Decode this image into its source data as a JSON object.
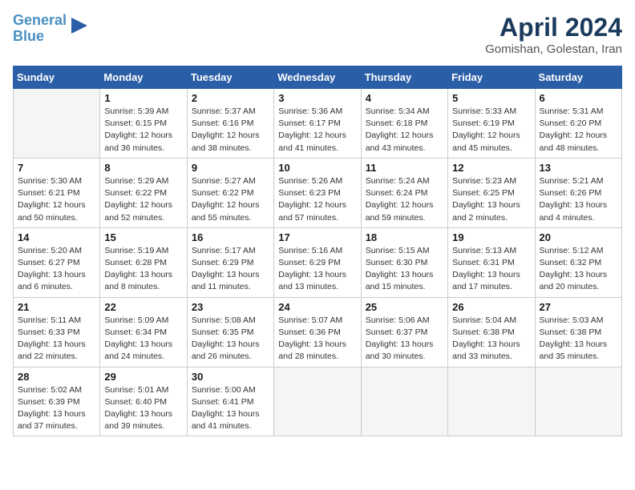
{
  "header": {
    "logo_line1": "General",
    "logo_line2": "Blue",
    "month_title": "April 2024",
    "location": "Gomishan, Golestan, Iran"
  },
  "calendar": {
    "days_of_week": [
      "Sunday",
      "Monday",
      "Tuesday",
      "Wednesday",
      "Thursday",
      "Friday",
      "Saturday"
    ],
    "weeks": [
      [
        {
          "num": "",
          "info": ""
        },
        {
          "num": "1",
          "info": "Sunrise: 5:39 AM\nSunset: 6:15 PM\nDaylight: 12 hours\nand 36 minutes."
        },
        {
          "num": "2",
          "info": "Sunrise: 5:37 AM\nSunset: 6:16 PM\nDaylight: 12 hours\nand 38 minutes."
        },
        {
          "num": "3",
          "info": "Sunrise: 5:36 AM\nSunset: 6:17 PM\nDaylight: 12 hours\nand 41 minutes."
        },
        {
          "num": "4",
          "info": "Sunrise: 5:34 AM\nSunset: 6:18 PM\nDaylight: 12 hours\nand 43 minutes."
        },
        {
          "num": "5",
          "info": "Sunrise: 5:33 AM\nSunset: 6:19 PM\nDaylight: 12 hours\nand 45 minutes."
        },
        {
          "num": "6",
          "info": "Sunrise: 5:31 AM\nSunset: 6:20 PM\nDaylight: 12 hours\nand 48 minutes."
        }
      ],
      [
        {
          "num": "7",
          "info": "Sunrise: 5:30 AM\nSunset: 6:21 PM\nDaylight: 12 hours\nand 50 minutes."
        },
        {
          "num": "8",
          "info": "Sunrise: 5:29 AM\nSunset: 6:22 PM\nDaylight: 12 hours\nand 52 minutes."
        },
        {
          "num": "9",
          "info": "Sunrise: 5:27 AM\nSunset: 6:22 PM\nDaylight: 12 hours\nand 55 minutes."
        },
        {
          "num": "10",
          "info": "Sunrise: 5:26 AM\nSunset: 6:23 PM\nDaylight: 12 hours\nand 57 minutes."
        },
        {
          "num": "11",
          "info": "Sunrise: 5:24 AM\nSunset: 6:24 PM\nDaylight: 12 hours\nand 59 minutes."
        },
        {
          "num": "12",
          "info": "Sunrise: 5:23 AM\nSunset: 6:25 PM\nDaylight: 13 hours\nand 2 minutes."
        },
        {
          "num": "13",
          "info": "Sunrise: 5:21 AM\nSunset: 6:26 PM\nDaylight: 13 hours\nand 4 minutes."
        }
      ],
      [
        {
          "num": "14",
          "info": "Sunrise: 5:20 AM\nSunset: 6:27 PM\nDaylight: 13 hours\nand 6 minutes."
        },
        {
          "num": "15",
          "info": "Sunrise: 5:19 AM\nSunset: 6:28 PM\nDaylight: 13 hours\nand 8 minutes."
        },
        {
          "num": "16",
          "info": "Sunrise: 5:17 AM\nSunset: 6:29 PM\nDaylight: 13 hours\nand 11 minutes."
        },
        {
          "num": "17",
          "info": "Sunrise: 5:16 AM\nSunset: 6:29 PM\nDaylight: 13 hours\nand 13 minutes."
        },
        {
          "num": "18",
          "info": "Sunrise: 5:15 AM\nSunset: 6:30 PM\nDaylight: 13 hours\nand 15 minutes."
        },
        {
          "num": "19",
          "info": "Sunrise: 5:13 AM\nSunset: 6:31 PM\nDaylight: 13 hours\nand 17 minutes."
        },
        {
          "num": "20",
          "info": "Sunrise: 5:12 AM\nSunset: 6:32 PM\nDaylight: 13 hours\nand 20 minutes."
        }
      ],
      [
        {
          "num": "21",
          "info": "Sunrise: 5:11 AM\nSunset: 6:33 PM\nDaylight: 13 hours\nand 22 minutes."
        },
        {
          "num": "22",
          "info": "Sunrise: 5:09 AM\nSunset: 6:34 PM\nDaylight: 13 hours\nand 24 minutes."
        },
        {
          "num": "23",
          "info": "Sunrise: 5:08 AM\nSunset: 6:35 PM\nDaylight: 13 hours\nand 26 minutes."
        },
        {
          "num": "24",
          "info": "Sunrise: 5:07 AM\nSunset: 6:36 PM\nDaylight: 13 hours\nand 28 minutes."
        },
        {
          "num": "25",
          "info": "Sunrise: 5:06 AM\nSunset: 6:37 PM\nDaylight: 13 hours\nand 30 minutes."
        },
        {
          "num": "26",
          "info": "Sunrise: 5:04 AM\nSunset: 6:38 PM\nDaylight: 13 hours\nand 33 minutes."
        },
        {
          "num": "27",
          "info": "Sunrise: 5:03 AM\nSunset: 6:38 PM\nDaylight: 13 hours\nand 35 minutes."
        }
      ],
      [
        {
          "num": "28",
          "info": "Sunrise: 5:02 AM\nSunset: 6:39 PM\nDaylight: 13 hours\nand 37 minutes."
        },
        {
          "num": "29",
          "info": "Sunrise: 5:01 AM\nSunset: 6:40 PM\nDaylight: 13 hours\nand 39 minutes."
        },
        {
          "num": "30",
          "info": "Sunrise: 5:00 AM\nSunset: 6:41 PM\nDaylight: 13 hours\nand 41 minutes."
        },
        {
          "num": "",
          "info": ""
        },
        {
          "num": "",
          "info": ""
        },
        {
          "num": "",
          "info": ""
        },
        {
          "num": "",
          "info": ""
        }
      ]
    ]
  }
}
